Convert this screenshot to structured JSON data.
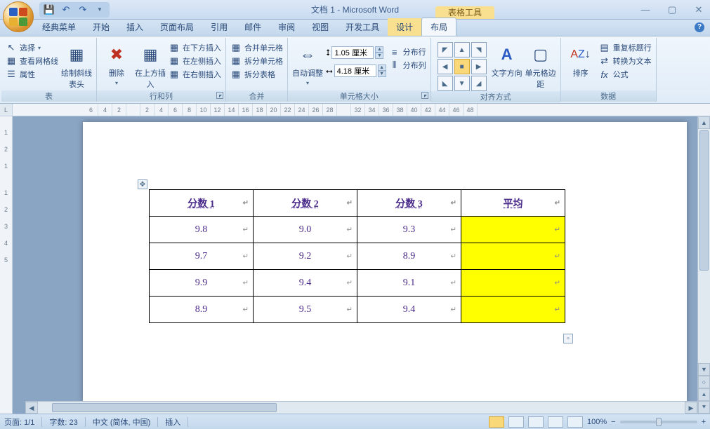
{
  "title": "文档 1 - Microsoft Word",
  "context_tool": "表格工具",
  "tabs": {
    "classic": "经典菜单",
    "home": "开始",
    "insert": "插入",
    "layout": "页面布局",
    "ref": "引用",
    "mail": "邮件",
    "review": "审阅",
    "view": "视图",
    "dev": "开发工具",
    "design": "设计",
    "tlayout": "布局"
  },
  "ribbon": {
    "table": {
      "label": "表",
      "select": "选择",
      "gridlines": "查看网格线",
      "props": "属性",
      "diag": "绘制斜线表头"
    },
    "rowcol": {
      "label": "行和列",
      "delete": "删除",
      "above": "在上方插入",
      "below": "在下方插入",
      "left": "在左侧插入",
      "right": "在右侧插入"
    },
    "merge": {
      "label": "合并",
      "merge": "合并单元格",
      "splitc": "拆分单元格",
      "splitt": "拆分表格"
    },
    "size": {
      "label": "单元格大小",
      "autofit": "自动调整",
      "h": "1.05 厘米",
      "w": "4.18 厘米",
      "distrow": "分布行",
      "distcol": "分布列"
    },
    "align": {
      "label": "对齐方式",
      "dir": "文字方向",
      "margin": "单元格边距"
    },
    "data": {
      "label": "数据",
      "sort": "排序",
      "repeat": "重复标题行",
      "totext": "转换为文本",
      "formula": "公式"
    }
  },
  "ruler_h": [
    "6",
    "4",
    "2",
    "",
    "2",
    "4",
    "6",
    "8",
    "10",
    "12",
    "14",
    "16",
    "18",
    "20",
    "22",
    "24",
    "26",
    "28",
    "",
    "32",
    "34",
    "36",
    "38",
    "40",
    "42",
    "44",
    "46",
    "48"
  ],
  "ruler_v": [
    "",
    "1",
    "2",
    "1",
    "",
    "1",
    "2",
    "3",
    "4",
    "5"
  ],
  "wtable": {
    "headers": [
      "分数 1",
      "分数 2",
      "分数 3",
      "平均"
    ],
    "rows": [
      [
        "9.8",
        "9.0",
        "9.3",
        ""
      ],
      [
        "9.7",
        "9.2",
        "8.9",
        ""
      ],
      [
        "9.9",
        "9.4",
        "9.1",
        ""
      ],
      [
        "8.9",
        "9.5",
        "9.4",
        ""
      ]
    ]
  },
  "status": {
    "page": "页面: 1/1",
    "words": "字数: 23",
    "lang": "中文 (简体, 中国)",
    "mode": "插入",
    "zoom": "100%"
  }
}
